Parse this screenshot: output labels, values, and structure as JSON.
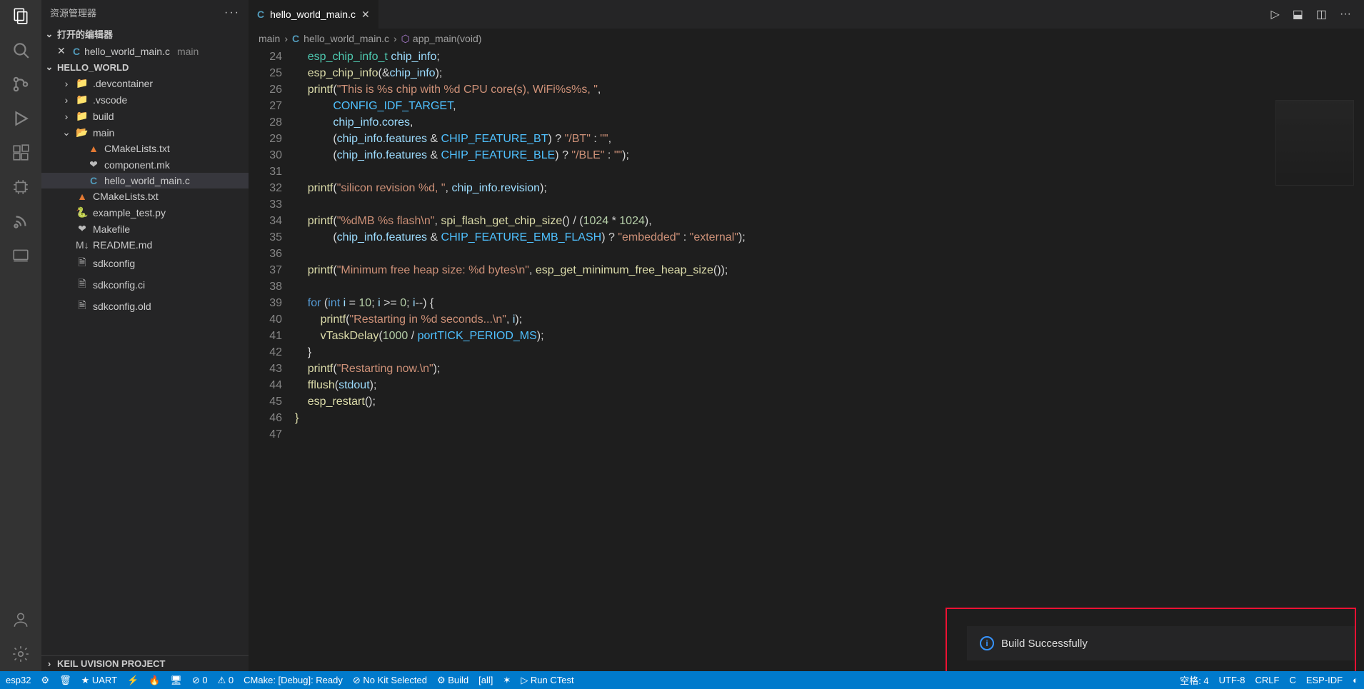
{
  "sidebar": {
    "title": "资源管理器",
    "openEditors": {
      "label": "打开的编辑器",
      "items": [
        {
          "file": "hello_world_main.c",
          "suffix": "main"
        }
      ]
    },
    "project": "HELLO_WORLD",
    "tree": [
      {
        "depth": 0,
        "chev": "›",
        "icon": "folder",
        "cls": "fold",
        "label": ".devcontainer"
      },
      {
        "depth": 0,
        "chev": "›",
        "icon": "folder",
        "cls": "fold",
        "label": ".vscode"
      },
      {
        "depth": 0,
        "chev": "›",
        "icon": "folder",
        "cls": "fold",
        "label": "build"
      },
      {
        "depth": 0,
        "chev": "⌄",
        "icon": "folder-open",
        "cls": "fold",
        "label": "main"
      },
      {
        "depth": 1,
        "chev": "",
        "icon": "▲",
        "cls": "cmake",
        "label": "CMakeLists.txt"
      },
      {
        "depth": 1,
        "chev": "",
        "icon": "❤",
        "cls": "mk",
        "label": "component.mk"
      },
      {
        "depth": 1,
        "chev": "",
        "icon": "C",
        "cls": "c-cyan",
        "label": "hello_world_main.c",
        "active": true
      },
      {
        "depth": 0,
        "chev": "",
        "icon": "▲",
        "cls": "cmake",
        "label": "CMakeLists.txt"
      },
      {
        "depth": 0,
        "chev": "",
        "icon": "🐍",
        "cls": "py",
        "label": "example_test.py"
      },
      {
        "depth": 0,
        "chev": "",
        "icon": "❤",
        "cls": "mk",
        "label": "Makefile"
      },
      {
        "depth": 0,
        "chev": "",
        "icon": "M↓",
        "cls": "mk",
        "label": "README.md"
      },
      {
        "depth": 0,
        "chev": "",
        "icon": "🗎",
        "cls": "mk",
        "label": "sdkconfig"
      },
      {
        "depth": 0,
        "chev": "",
        "icon": "🗎",
        "cls": "mk",
        "label": "sdkconfig.ci"
      },
      {
        "depth": 0,
        "chev": "",
        "icon": "🗎",
        "cls": "mk",
        "label": "sdkconfig.old"
      }
    ],
    "bottom": "KEIL UVISION PROJECT"
  },
  "tab": {
    "file": "hello_world_main.c"
  },
  "breadcrumbs": {
    "p0": "main",
    "p1": "hello_world_main.c",
    "p2": "app_main(void)"
  },
  "code": {
    "startLine": 24,
    "lines": [
      [
        {
          "t": "    ",
          "c": "plain"
        },
        {
          "t": "esp_chip_info_t",
          "c": "type"
        },
        {
          "t": " ",
          "c": "plain"
        },
        {
          "t": "chip_info",
          "c": "var"
        },
        {
          "t": ";",
          "c": "plain"
        }
      ],
      [
        {
          "t": "    ",
          "c": "plain"
        },
        {
          "t": "esp_chip_info",
          "c": "fn"
        },
        {
          "t": "(&",
          "c": "plain"
        },
        {
          "t": "chip_info",
          "c": "var"
        },
        {
          "t": ");",
          "c": "plain"
        }
      ],
      [
        {
          "t": "    ",
          "c": "plain"
        },
        {
          "t": "printf",
          "c": "fn"
        },
        {
          "t": "(",
          "c": "plain"
        },
        {
          "t": "\"This is %s chip with %d CPU core(s), WiFi%s%s, \"",
          "c": "str"
        },
        {
          "t": ",",
          "c": "plain"
        }
      ],
      [
        {
          "t": "            ",
          "c": "plain"
        },
        {
          "t": "CONFIG_IDF_TARGET",
          "c": "const"
        },
        {
          "t": ",",
          "c": "plain"
        }
      ],
      [
        {
          "t": "            ",
          "c": "plain"
        },
        {
          "t": "chip_info",
          "c": "var"
        },
        {
          "t": ".",
          "c": "plain"
        },
        {
          "t": "cores",
          "c": "var"
        },
        {
          "t": ",",
          "c": "plain"
        }
      ],
      [
        {
          "t": "            (",
          "c": "plain"
        },
        {
          "t": "chip_info",
          "c": "var"
        },
        {
          "t": ".",
          "c": "plain"
        },
        {
          "t": "features",
          "c": "var"
        },
        {
          "t": " & ",
          "c": "plain"
        },
        {
          "t": "CHIP_FEATURE_BT",
          "c": "const"
        },
        {
          "t": ") ? ",
          "c": "plain"
        },
        {
          "t": "\"/BT\"",
          "c": "str"
        },
        {
          "t": " : ",
          "c": "plain"
        },
        {
          "t": "\"\"",
          "c": "str"
        },
        {
          "t": ",",
          "c": "plain"
        }
      ],
      [
        {
          "t": "            (",
          "c": "plain"
        },
        {
          "t": "chip_info",
          "c": "var"
        },
        {
          "t": ".",
          "c": "plain"
        },
        {
          "t": "features",
          "c": "var"
        },
        {
          "t": " & ",
          "c": "plain"
        },
        {
          "t": "CHIP_FEATURE_BLE",
          "c": "const"
        },
        {
          "t": ") ? ",
          "c": "plain"
        },
        {
          "t": "\"/BLE\"",
          "c": "str"
        },
        {
          "t": " : ",
          "c": "plain"
        },
        {
          "t": "\"\"",
          "c": "str"
        },
        {
          "t": ");",
          "c": "plain"
        }
      ],
      [],
      [
        {
          "t": "    ",
          "c": "plain"
        },
        {
          "t": "printf",
          "c": "fn"
        },
        {
          "t": "(",
          "c": "plain"
        },
        {
          "t": "\"silicon revision %d, \"",
          "c": "str"
        },
        {
          "t": ", ",
          "c": "plain"
        },
        {
          "t": "chip_info",
          "c": "var"
        },
        {
          "t": ".",
          "c": "plain"
        },
        {
          "t": "revision",
          "c": "var"
        },
        {
          "t": ");",
          "c": "plain"
        }
      ],
      [],
      [
        {
          "t": "    ",
          "c": "plain"
        },
        {
          "t": "printf",
          "c": "fn"
        },
        {
          "t": "(",
          "c": "plain"
        },
        {
          "t": "\"%dMB %s flash\\n\"",
          "c": "str"
        },
        {
          "t": ", ",
          "c": "plain"
        },
        {
          "t": "spi_flash_get_chip_size",
          "c": "fn"
        },
        {
          "t": "() / (",
          "c": "plain"
        },
        {
          "t": "1024",
          "c": "num"
        },
        {
          "t": " * ",
          "c": "plain"
        },
        {
          "t": "1024",
          "c": "num"
        },
        {
          "t": "),",
          "c": "plain"
        }
      ],
      [
        {
          "t": "            (",
          "c": "plain"
        },
        {
          "t": "chip_info",
          "c": "var"
        },
        {
          "t": ".",
          "c": "plain"
        },
        {
          "t": "features",
          "c": "var"
        },
        {
          "t": " & ",
          "c": "plain"
        },
        {
          "t": "CHIP_FEATURE_EMB_FLASH",
          "c": "const"
        },
        {
          "t": ") ? ",
          "c": "plain"
        },
        {
          "t": "\"embedded\"",
          "c": "str"
        },
        {
          "t": " : ",
          "c": "plain"
        },
        {
          "t": "\"external\"",
          "c": "str"
        },
        {
          "t": ");",
          "c": "plain"
        }
      ],
      [],
      [
        {
          "t": "    ",
          "c": "plain"
        },
        {
          "t": "printf",
          "c": "fn"
        },
        {
          "t": "(",
          "c": "plain"
        },
        {
          "t": "\"Minimum free heap size: %d bytes\\n\"",
          "c": "str"
        },
        {
          "t": ", ",
          "c": "plain"
        },
        {
          "t": "esp_get_minimum_free_heap_size",
          "c": "fn"
        },
        {
          "t": "());",
          "c": "plain"
        }
      ],
      [],
      [
        {
          "t": "    ",
          "c": "plain"
        },
        {
          "t": "for",
          "c": "kw"
        },
        {
          "t": " (",
          "c": "plain"
        },
        {
          "t": "int",
          "c": "kw"
        },
        {
          "t": " ",
          "c": "plain"
        },
        {
          "t": "i",
          "c": "var"
        },
        {
          "t": " = ",
          "c": "plain"
        },
        {
          "t": "10",
          "c": "num"
        },
        {
          "t": "; ",
          "c": "plain"
        },
        {
          "t": "i",
          "c": "var"
        },
        {
          "t": " >= ",
          "c": "plain"
        },
        {
          "t": "0",
          "c": "num"
        },
        {
          "t": "; ",
          "c": "plain"
        },
        {
          "t": "i",
          "c": "var"
        },
        {
          "t": "--) {",
          "c": "plain"
        }
      ],
      [
        {
          "t": "        ",
          "c": "plain"
        },
        {
          "t": "printf",
          "c": "fn"
        },
        {
          "t": "(",
          "c": "plain"
        },
        {
          "t": "\"Restarting in %d seconds...\\n\"",
          "c": "str"
        },
        {
          "t": ", ",
          "c": "plain"
        },
        {
          "t": "i",
          "c": "var"
        },
        {
          "t": ");",
          "c": "plain"
        }
      ],
      [
        {
          "t": "        ",
          "c": "plain"
        },
        {
          "t": "vTaskDelay",
          "c": "fn"
        },
        {
          "t": "(",
          "c": "plain"
        },
        {
          "t": "1000",
          "c": "num"
        },
        {
          "t": " / ",
          "c": "plain"
        },
        {
          "t": "portTICK_PERIOD_MS",
          "c": "const"
        },
        {
          "t": ");",
          "c": "plain"
        }
      ],
      [
        {
          "t": "    }",
          "c": "plain"
        }
      ],
      [
        {
          "t": "    ",
          "c": "plain"
        },
        {
          "t": "printf",
          "c": "fn"
        },
        {
          "t": "(",
          "c": "plain"
        },
        {
          "t": "\"Restarting now.\\n\"",
          "c": "str"
        },
        {
          "t": ");",
          "c": "plain"
        }
      ],
      [
        {
          "t": "    ",
          "c": "plain"
        },
        {
          "t": "fflush",
          "c": "fn"
        },
        {
          "t": "(",
          "c": "plain"
        },
        {
          "t": "stdout",
          "c": "var"
        },
        {
          "t": ");",
          "c": "plain"
        }
      ],
      [
        {
          "t": "    ",
          "c": "plain"
        },
        {
          "t": "esp_restart",
          "c": "fn"
        },
        {
          "t": "();",
          "c": "plain"
        }
      ],
      [
        {
          "t": "}",
          "c": "fn"
        }
      ],
      []
    ]
  },
  "notification": {
    "text": "Build Successfully"
  },
  "status": {
    "left": [
      "esp32",
      "⚙",
      "🗑",
      "★ UART",
      "⚡",
      "🔥",
      "🖥",
      "⊘ 0",
      "⚠ 0",
      "CMake: [Debug]: Ready",
      "⊘ No Kit Selected",
      "⚙ Build",
      "[all]",
      "✶",
      "▷ Run CTest"
    ],
    "right": [
      "空格: 4",
      "UTF-8",
      "CRLF",
      "C",
      "ESP-IDF",
      "◐"
    ]
  }
}
